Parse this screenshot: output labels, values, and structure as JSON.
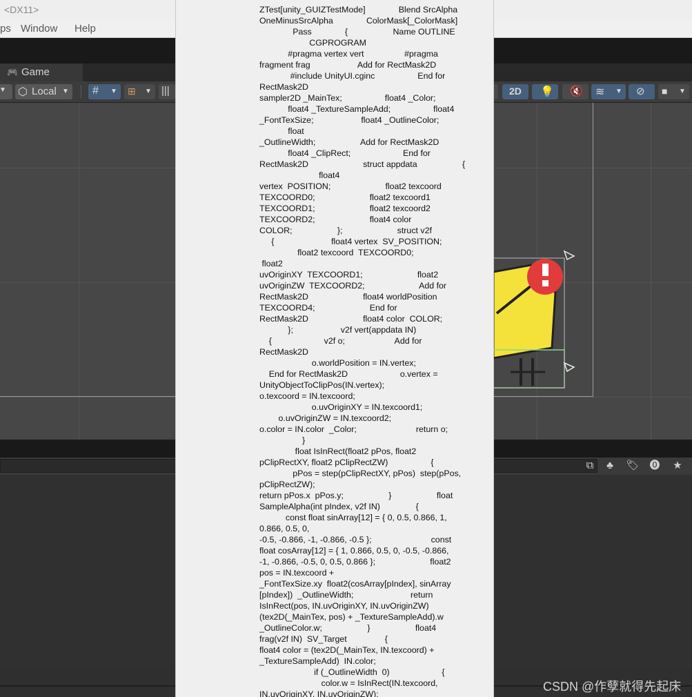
{
  "window": {
    "title": "<DX11>"
  },
  "menu": {
    "items": [
      "ps",
      "Window",
      "Help"
    ]
  },
  "tabs": {
    "game_label": "Game"
  },
  "toolbar": {
    "pivot_label": "Local",
    "mode_2d_label": "2D"
  },
  "scene": {
    "accent_color": "#f4e23a",
    "selection_color": "#8fd18f",
    "warning_color": "#e23b3b"
  },
  "code": {
    "lines": [
      "ZTest[unity_GUIZTestMode]              Blend SrcAlpha",
      "OneMinusSrcAlpha              ColorMask[_ColorMask]",
      "              Pass              {                   Name OUTLINE",
      "                     CGPROGRAM",
      "            #pragma vertex vert                 #pragma",
      "fragment frag                    Add for RectMask2D",
      "             #include UnityUI.cginc                  End for",
      "RectMask2D",
      "sampler2D _MainTex;                  float4 _Color;",
      "            float4 _TextureSampleAdd;                  float4",
      "_FontTexSize;                    float4 _OutlineColor;",
      "            float",
      "_OutlineWidth;                   Add for RectMask2D",
      "            float4 _ClipRect;                      End for",
      "RectMask2D                       struct appdata                   {",
      "                         float4",
      "vertex  POSITION;                       float2 texcoord",
      "TEXCOORD0;                       float2 texcoord1",
      "TEXCOORD1;                       float2 texcoord2",
      "TEXCOORD2;                       float4 color",
      "COLOR;                   };                       struct v2f",
      "     {                        float4 vertex  SV_POSITION;",
      "                float2 texcoord  TEXCOORD0;",
      " float2",
      "uvOriginXY  TEXCOORD1;                       float2",
      "uvOriginZW  TEXCOORD2;                       Add for",
      "RectMask2D                       float4 worldPosition",
      "TEXCOORD4;                       End for",
      "RectMask2D                       float4 color  COLOR;",
      "            };                    v2f vert(appdata IN)",
      "    {                      v2f o;                     Add for",
      "RectMask2D",
      "                      o.worldPosition = IN.vertex;",
      "    End for RectMask2D                      o.vertex =",
      "UnityObjectToClipPos(IN.vertex);",
      "o.texcoord = IN.texcoord;",
      "                      o.uvOriginXY = IN.texcoord1;",
      "        o.uvOriginZW = IN.texcoord2;",
      "o.color = IN.color  _Color;                         return o;",
      "                  }",
      "               float IsInRect(float2 pPos, float2",
      "pClipRectXY, float2 pClipRectZW)                  {",
      "              pPos = step(pClipRectXY, pPos)  step(pPos,",
      "pClipRectZW);",
      "return pPos.x  pPos.y;                   }                   float",
      "SampleAlpha(int pIndex, v2f IN)               {",
      "           const float sinArray[12] = { 0, 0.5, 0.866, 1,",
      "0.866, 0.5, 0,",
      "-0.5, -0.866, -1, -0.866, -0.5 };                         const",
      "float cosArray[12] = { 1, 0.866, 0.5, 0, -0.5, -0.866,",
      "-1, -0.866, -0.5, 0, 0.5, 0.866 };                       float2",
      "pos = IN.texcoord +",
      "_FontTexSize.xy  float2(cosArray[pIndex], sinArray",
      "[pIndex])  _OutlineWidth;                        return",
      "IsInRect(pos, IN.uvOriginXY, IN.uvOriginZW)",
      "(tex2D(_MainTex, pos) + _TextureSampleAdd).w",
      "_OutlineColor.w;                   }                   float4",
      "frag(v2f IN)  SV_Target                {",
      "float4 color = (tex2D(_MainTex, IN.texcoord) +",
      "_TextureSampleAdd)  IN.color;",
      "                       if (_OutlineWidth  0)                      {",
      "                          color.w = IsInRect(IN.texcoord,",
      "IN.uvOriginXY, IN.uvOriginZW);"
    ]
  },
  "watermark": "CSDN @作孽就得先起床"
}
